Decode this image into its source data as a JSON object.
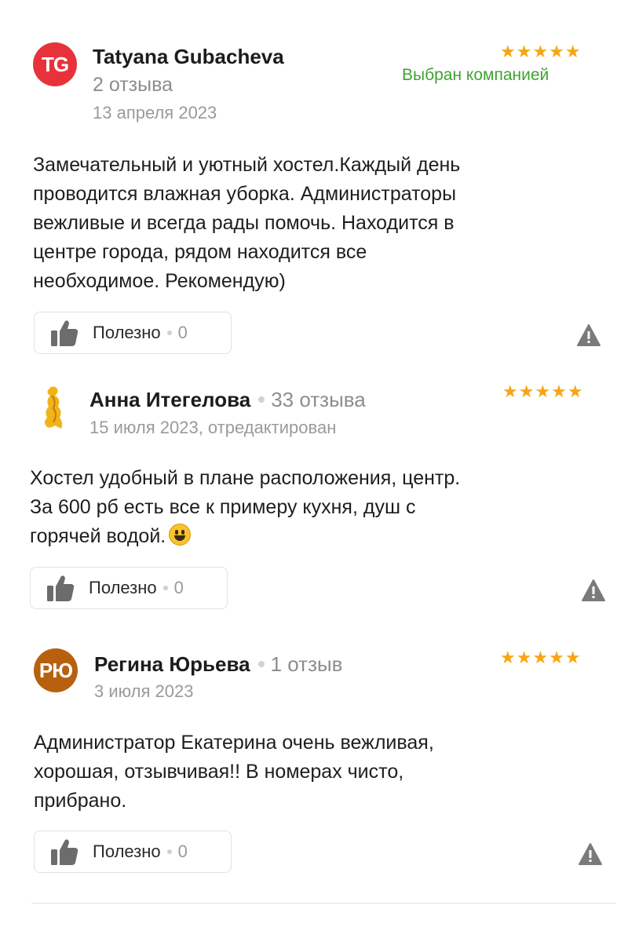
{
  "colors": {
    "star": "#f7a514",
    "badge_green": "#3fa330",
    "avatar_tg": "#e8323b",
    "avatar_ryu": "#b7610f"
  },
  "reviews": [
    {
      "avatar_initials": "TG",
      "author": "Tatyana Gubacheva",
      "reviews_count": "2 отзыва",
      "date": "13 апреля 2023",
      "rating": 5,
      "stars": "★★★★★",
      "badge": "Выбран компанией",
      "text_lines": [
        "Замечательный и уютный хостел.Каждый день",
        "проводится влажная уборка. Администраторы",
        "вежливые и всегда рады помочь. Находится в",
        "центре города, рядом находится все",
        "необходимое. Рекомендую)"
      ],
      "helpful_label": "Полезно",
      "helpful_count": "0",
      "icons": [
        "thumbs-up-icon",
        "warning-icon"
      ]
    },
    {
      "avatar_icon": "golden-figure-avatar-icon",
      "author": "Анна Итегелова",
      "reviews_count": "33 отзыва",
      "date": "15 июля 2023, отредактирован",
      "rating": 5,
      "stars": "★★★★★",
      "text_lines": [
        "Хостел удобный в плане расположения, центр.",
        "За 600 рб есть все к примеру кухня, душ с",
        "горячей водой."
      ],
      "emoji": "grinning-face-emoji",
      "helpful_label": "Полезно",
      "helpful_count": "0",
      "icons": [
        "thumbs-up-icon",
        "warning-icon"
      ]
    },
    {
      "avatar_initials": "РЮ",
      "author": "Регина Юрьева",
      "reviews_count": "1 отзыв",
      "date": "3 июля 2023",
      "rating": 5,
      "stars": "★★★★★",
      "text_lines": [
        "Администратор Екатерина очень вежливая,",
        "хорошая, отзывчивая!! В номерах чисто,",
        "прибрано."
      ],
      "helpful_label": "Полезно",
      "helpful_count": "0",
      "icons": [
        "thumbs-up-icon",
        "warning-icon"
      ]
    }
  ]
}
